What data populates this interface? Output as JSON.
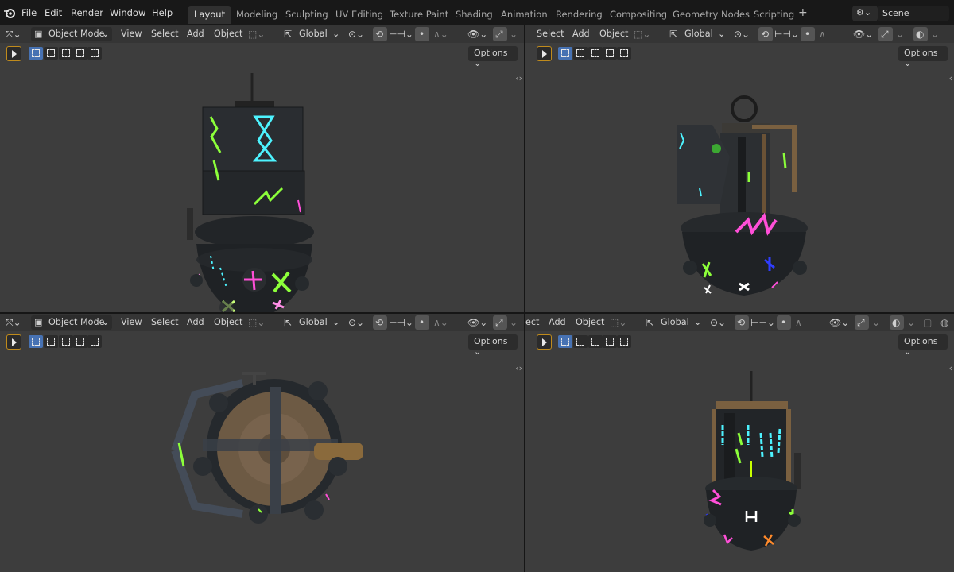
{
  "menu": [
    "File",
    "Edit",
    "Render",
    "Window",
    "Help"
  ],
  "workspaces": [
    "Layout",
    "Modeling",
    "Sculpting",
    "UV Editing",
    "Texture Paint",
    "Shading",
    "Animation",
    "Rendering",
    "Compositing",
    "Geometry Nodes",
    "Scripting"
  ],
  "active_workspace": "Layout",
  "scene": {
    "name": "Scene"
  },
  "viewports": [
    {
      "mode": "Object Mode",
      "menus": [
        "View",
        "Select",
        "Add",
        "Object"
      ],
      "orientation": "Global",
      "options": "Options"
    },
    {
      "mode": "",
      "menus": [
        "Select",
        "Add",
        "Object"
      ],
      "orientation": "Global",
      "options": "Options"
    },
    {
      "mode": "Object Mode",
      "menus": [
        "View",
        "Select",
        "Add",
        "Object"
      ],
      "orientation": "Global",
      "options": "Options"
    },
    {
      "mode": "",
      "menus": [
        "ect",
        "Add",
        "Object"
      ],
      "orientation": "Global",
      "options": "Options"
    }
  ],
  "colors": {
    "accent": "#4772b3",
    "tool_outline": "#c08b1c",
    "glow_green": "#8cff3a",
    "glow_cyan": "#4df3ff",
    "glow_pink": "#ff4fd8",
    "glow_blue": "#2f3dff",
    "brass": "#8a6a3c"
  },
  "icons": [
    "blender-logo-icon",
    "editor-type-icon",
    "object-mode-icon",
    "transform-pivot-icon",
    "snap-icon",
    "proportional-edit-icon",
    "visibility-icon",
    "gizmo-icon",
    "select-box-icon"
  ]
}
